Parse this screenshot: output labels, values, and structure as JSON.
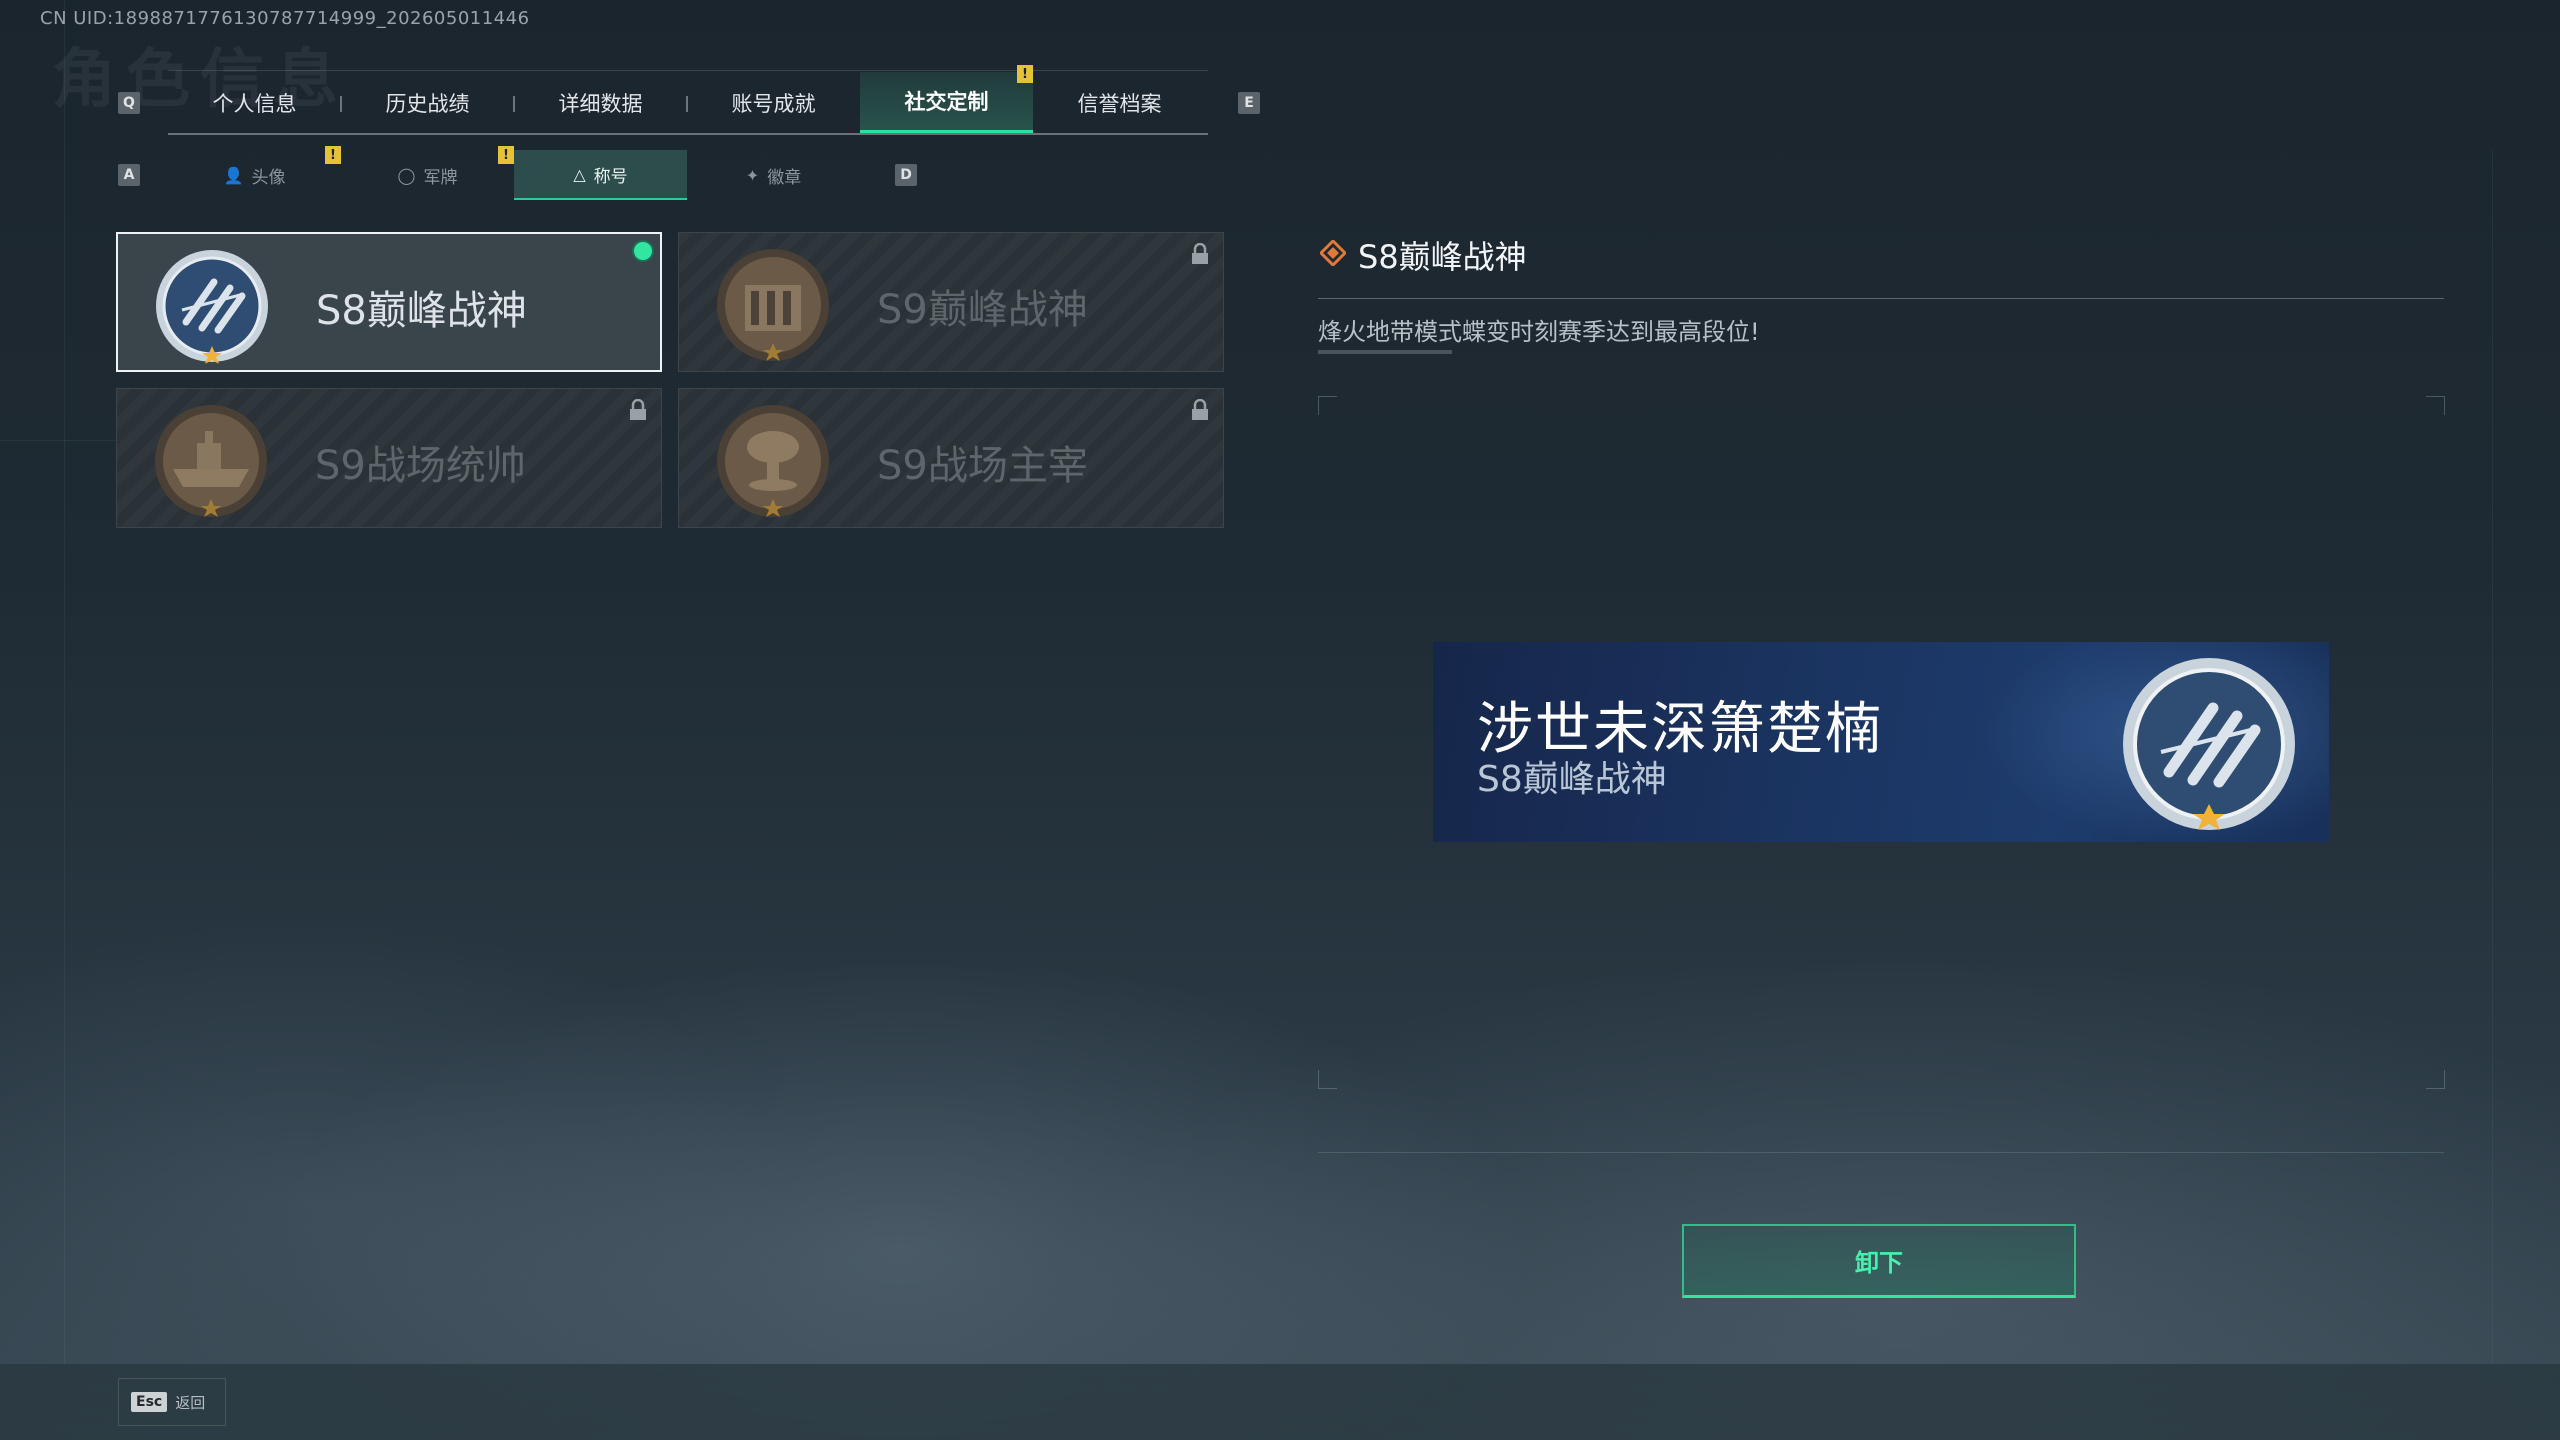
{
  "uid_text": "CN UID:1898871776130787714999_202605011446",
  "bg_title": "角色信息",
  "key_hints": {
    "prev_tab": "Q",
    "next_tab": "E",
    "prev_sub": "A",
    "next_sub": "D"
  },
  "tabs": [
    {
      "label": "个人信息"
    },
    {
      "label": "历史战绩"
    },
    {
      "label": "详细数据"
    },
    {
      "label": "账号成就"
    },
    {
      "label": "社交定制"
    },
    {
      "label": "信誉档案"
    }
  ],
  "warn_badge": "!",
  "subtabs": [
    {
      "label": "头像",
      "icon": "person-icon"
    },
    {
      "label": "军牌",
      "icon": "dogtag-icon"
    },
    {
      "label": "称号",
      "icon": "title-icon"
    },
    {
      "label": "徽章",
      "icon": "badge-icon"
    }
  ],
  "cards": [
    {
      "label": "S8巅峰战神",
      "state": "equipped"
    },
    {
      "label": "S9巅峰战神",
      "state": "locked"
    },
    {
      "label": "S9战场统帅",
      "state": "locked"
    },
    {
      "label": "S9战场主宰",
      "state": "locked"
    }
  ],
  "detail": {
    "title": "S8巅峰战神",
    "description": "烽火地带模式蝶变时刻赛季达到最高段位!"
  },
  "banner": {
    "player_name": "涉世未深箫楚楠",
    "title": "S8巅峰战神"
  },
  "unequip_label": "卸下",
  "back": {
    "key": "Esc",
    "label": "返回"
  },
  "colors": {
    "accent": "#30e6a0",
    "warning": "#e6c238",
    "banner_bg": "#1b3562"
  }
}
